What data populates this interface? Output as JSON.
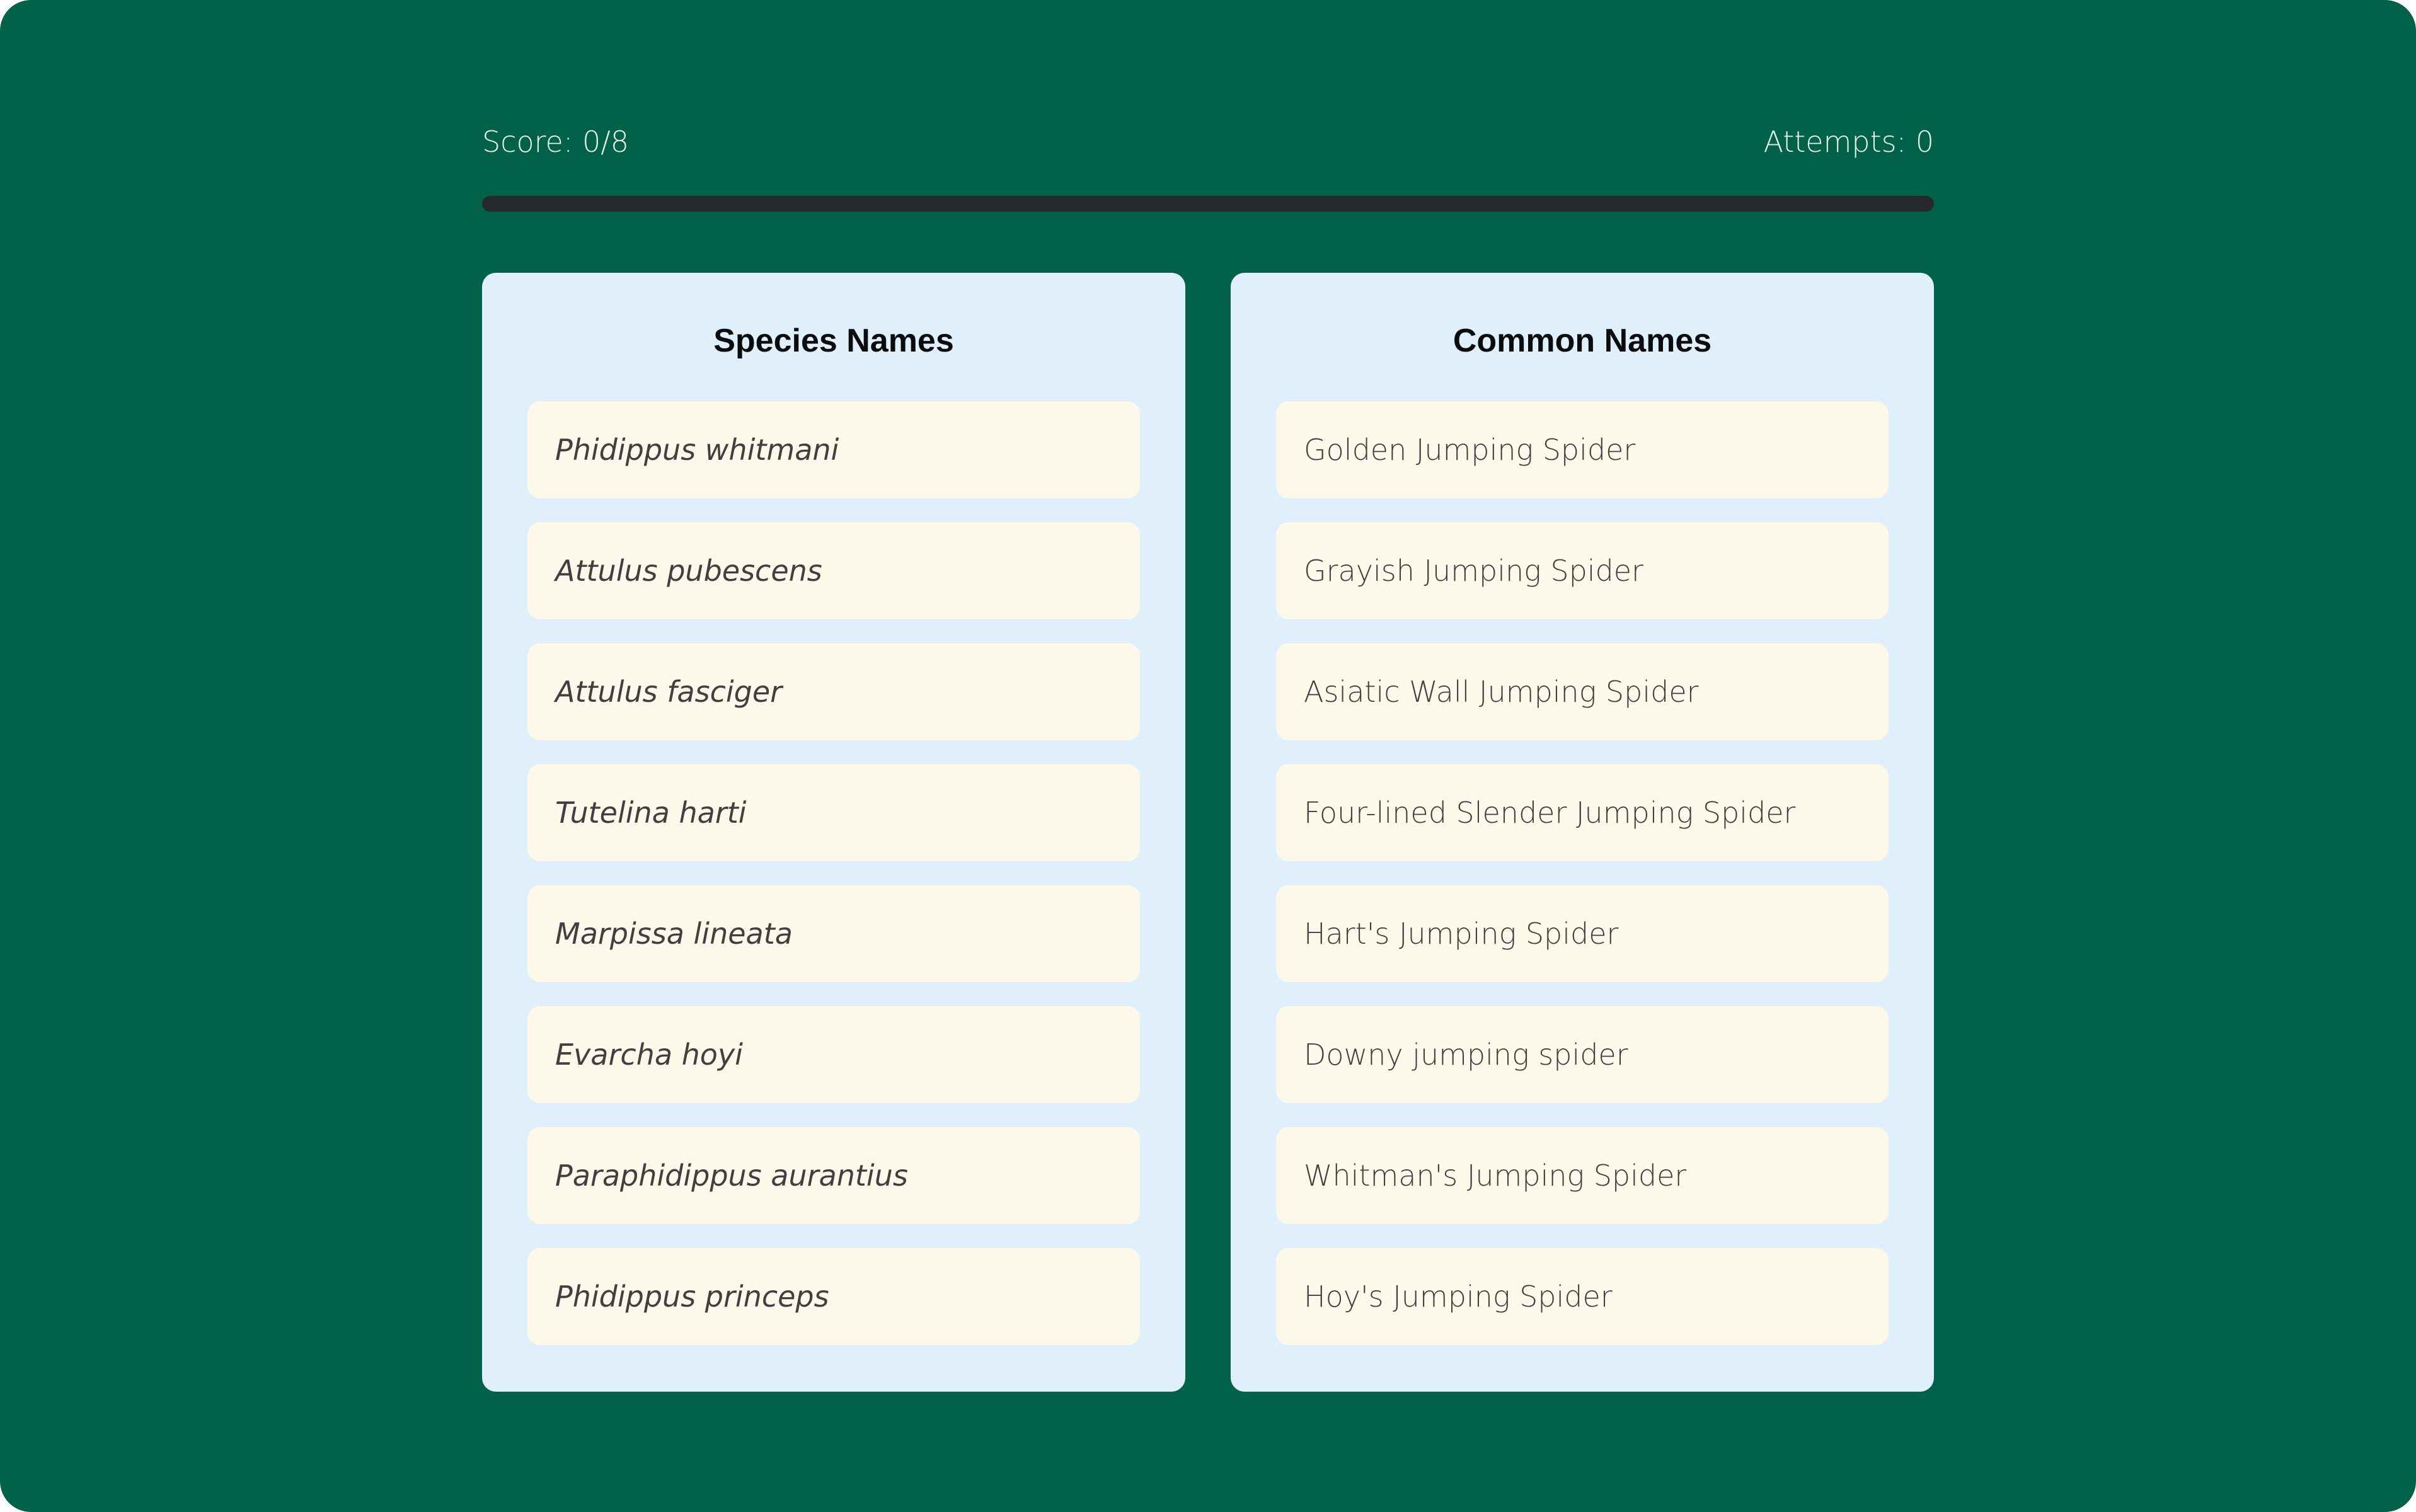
{
  "stats": {
    "score": "Score: 0/8",
    "attempts": "Attempts: 0",
    "progress_fraction": 0
  },
  "columns": {
    "species": {
      "title": "Species Names",
      "items": [
        "Phidippus whitmani",
        "Attulus pubescens",
        "Attulus fasciger",
        "Tutelina harti",
        "Marpissa lineata",
        "Evarcha hoyi",
        "Paraphidippus aurantius",
        "Phidippus princeps"
      ]
    },
    "common": {
      "title": "Common Names",
      "items": [
        "Golden Jumping Spider",
        "Grayish Jumping Spider",
        "Asiatic Wall Jumping Spider",
        "Four-lined Slender Jumping Spider",
        "Hart's Jumping Spider",
        "Downy jumping spider",
        "Whitman's Jumping Spider",
        "Hoy's Jumping Spider"
      ]
    }
  },
  "colors": {
    "background": "#016149",
    "panel": "#dff0fc",
    "card": "#fdf9ea",
    "progress_track": "#262a2c"
  }
}
